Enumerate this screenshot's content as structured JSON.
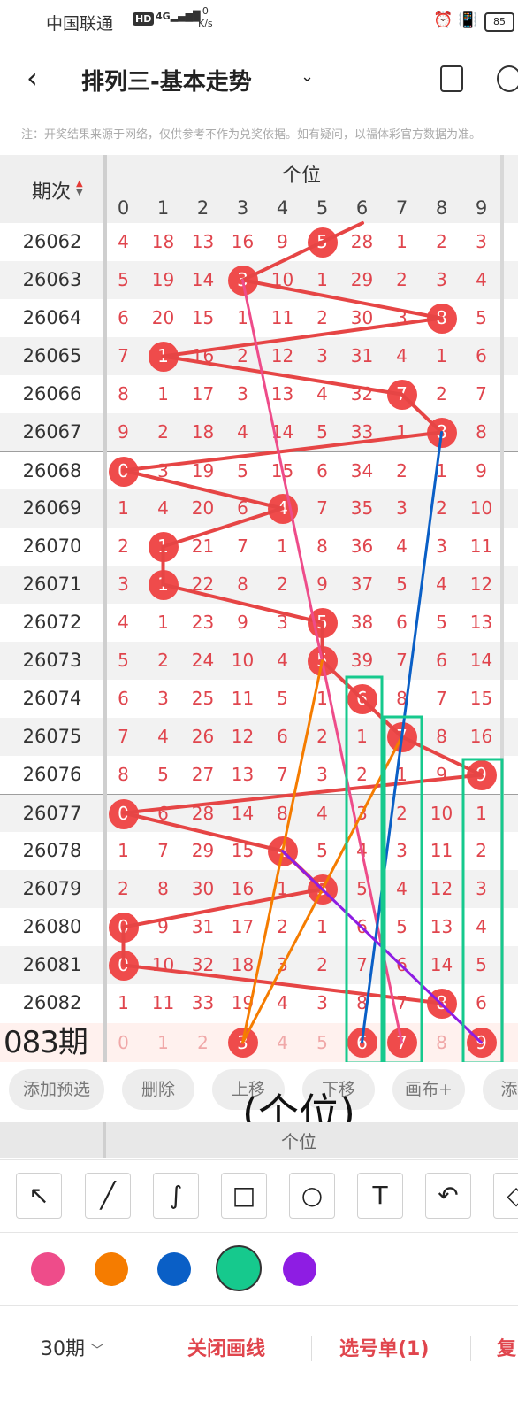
{
  "status_bar": {
    "carrier": "中国联通",
    "hd": "HD",
    "signal": "4G",
    "speed_value": "0",
    "speed_unit": "K/s",
    "battery": "85"
  },
  "header": {
    "title": "排列三-基本走势"
  },
  "notice": "注：开奖结果来源于网络，仅供参考不作为兑奖依据。如有疑问，以福体彩官方数据为准。",
  "table": {
    "period_header": "期次",
    "position_header": "个位",
    "digits": [
      "0",
      "1",
      "2",
      "3",
      "4",
      "5",
      "6",
      "7",
      "8",
      "9"
    ],
    "rows": [
      {
        "period": "26062",
        "cells": [
          "4",
          "18",
          "13",
          "16",
          "9",
          "5",
          "28",
          "1",
          "2",
          "3"
        ],
        "hit": 5
      },
      {
        "period": "26063",
        "cells": [
          "5",
          "19",
          "14",
          "3",
          "10",
          "1",
          "29",
          "2",
          "3",
          "4"
        ],
        "hit": 3
      },
      {
        "period": "26064",
        "cells": [
          "6",
          "20",
          "15",
          "1",
          "11",
          "2",
          "30",
          "3",
          "8",
          "5"
        ],
        "hit": 8
      },
      {
        "period": "26065",
        "cells": [
          "7",
          "1",
          "16",
          "2",
          "12",
          "3",
          "31",
          "4",
          "1",
          "6"
        ],
        "hit": 1
      },
      {
        "period": "26066",
        "cells": [
          "8",
          "1",
          "17",
          "3",
          "13",
          "4",
          "32",
          "7",
          "2",
          "7"
        ],
        "hit": 7
      },
      {
        "period": "26067",
        "cells": [
          "9",
          "2",
          "18",
          "4",
          "14",
          "5",
          "33",
          "1",
          "8",
          "8"
        ],
        "hit": 8
      },
      {
        "period": "26068",
        "cells": [
          "0",
          "3",
          "19",
          "5",
          "15",
          "6",
          "34",
          "2",
          "1",
          "9"
        ],
        "hit": 0
      },
      {
        "period": "26069",
        "cells": [
          "1",
          "4",
          "20",
          "6",
          "4",
          "7",
          "35",
          "3",
          "2",
          "10"
        ],
        "hit": 4
      },
      {
        "period": "26070",
        "cells": [
          "2",
          "1",
          "21",
          "7",
          "1",
          "8",
          "36",
          "4",
          "3",
          "11"
        ],
        "hit": 1
      },
      {
        "period": "26071",
        "cells": [
          "3",
          "1",
          "22",
          "8",
          "2",
          "9",
          "37",
          "5",
          "4",
          "12"
        ],
        "hit": 1
      },
      {
        "period": "26072",
        "cells": [
          "4",
          "1",
          "23",
          "9",
          "3",
          "5",
          "38",
          "6",
          "5",
          "13"
        ],
        "hit": 5
      },
      {
        "period": "26073",
        "cells": [
          "5",
          "2",
          "24",
          "10",
          "4",
          "5",
          "39",
          "7",
          "6",
          "14"
        ],
        "hit": 5
      },
      {
        "period": "26074",
        "cells": [
          "6",
          "3",
          "25",
          "11",
          "5",
          "1",
          "6",
          "8",
          "7",
          "15"
        ],
        "hit": 6
      },
      {
        "period": "26075",
        "cells": [
          "7",
          "4",
          "26",
          "12",
          "6",
          "2",
          "1",
          "7",
          "8",
          "16"
        ],
        "hit": 7
      },
      {
        "period": "26076",
        "cells": [
          "8",
          "5",
          "27",
          "13",
          "7",
          "3",
          "2",
          "1",
          "9",
          "9"
        ],
        "hit": 9
      },
      {
        "period": "26077",
        "cells": [
          "0",
          "6",
          "28",
          "14",
          "8",
          "4",
          "3",
          "2",
          "10",
          "1"
        ],
        "hit": 0
      },
      {
        "period": "26078",
        "cells": [
          "1",
          "7",
          "29",
          "15",
          "4",
          "5",
          "4",
          "3",
          "11",
          "2"
        ],
        "hit": 4
      },
      {
        "period": "26079",
        "cells": [
          "2",
          "8",
          "30",
          "16",
          "1",
          "5",
          "5",
          "4",
          "12",
          "3"
        ],
        "hit": 5
      },
      {
        "period": "26080",
        "cells": [
          "0",
          "9",
          "31",
          "17",
          "2",
          "1",
          "6",
          "5",
          "13",
          "4"
        ],
        "hit": 0
      },
      {
        "period": "26081",
        "cells": [
          "0",
          "10",
          "32",
          "18",
          "3",
          "2",
          "7",
          "6",
          "14",
          "5"
        ],
        "hit": 0
      },
      {
        "period": "26082",
        "cells": [
          "1",
          "11",
          "33",
          "19",
          "4",
          "3",
          "8",
          "7",
          "8",
          "6"
        ],
        "hit": 8
      }
    ],
    "prediction": {
      "label": "083期",
      "cells": [
        "0",
        "1",
        "2",
        "3",
        "4",
        "5",
        "6",
        "7",
        "8",
        "9"
      ],
      "selected": [
        3,
        6,
        7,
        9
      ]
    }
  },
  "actions": {
    "add_preselect": "添加预选",
    "delete": "删除",
    "move_up": "上移",
    "move_down": "下移",
    "canvas_plus": "画布+",
    "more": "添"
  },
  "overlay_text": {
    "position_caption": "(个位)",
    "sticky_header": "个位"
  },
  "tools": [
    "arrow-tool-icon",
    "line-tool-icon",
    "curve-tool-icon",
    "rectangle-tool-icon",
    "circle-tool-icon",
    "text-tool-icon",
    "undo-icon",
    "clear-icon"
  ],
  "palette": [
    {
      "name": "pink",
      "color": "#ee4c8a"
    },
    {
      "name": "orange",
      "color": "#f57c00"
    },
    {
      "name": "blue",
      "color": "#0a5fc6"
    },
    {
      "name": "green",
      "color": "#16c98d",
      "selected": true
    },
    {
      "name": "purple",
      "color": "#8e1de3"
    }
  ],
  "bottom": {
    "period_count": "30期",
    "close_drawing": "关闭画线",
    "selection_list": "选号单(1)",
    "more_label": "复"
  }
}
